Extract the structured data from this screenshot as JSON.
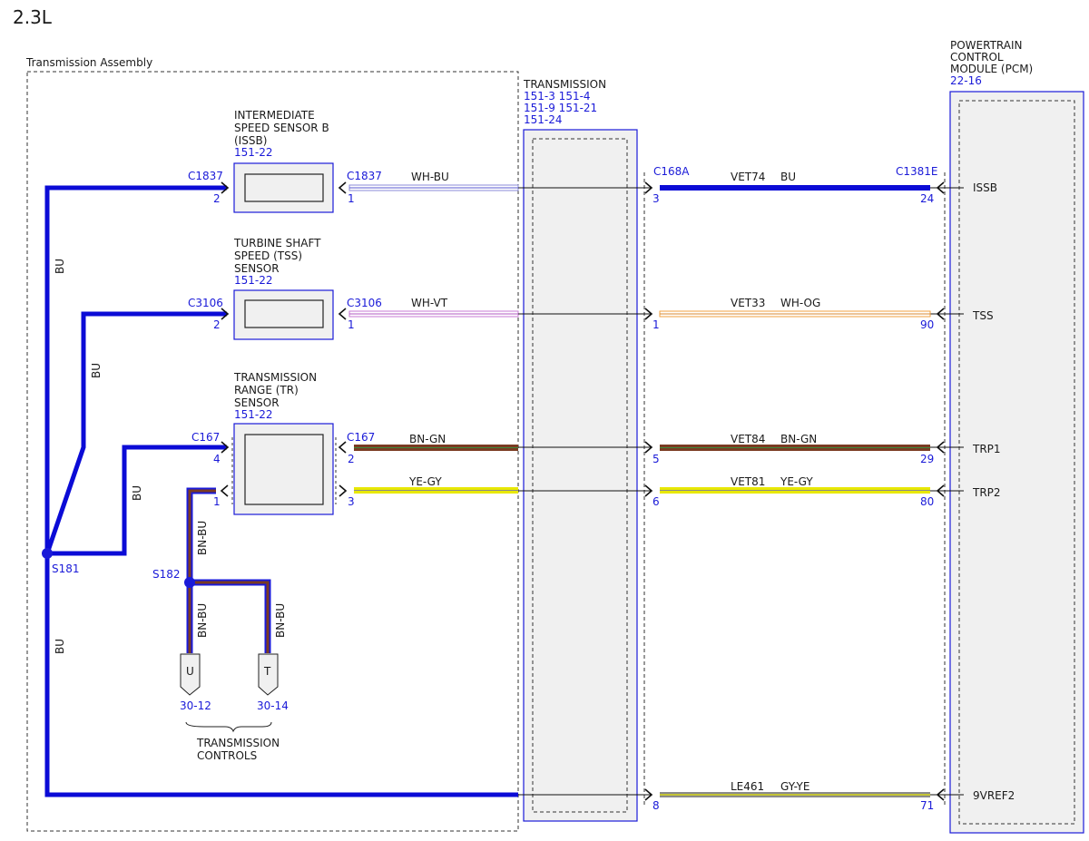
{
  "engine_label": "2.3L",
  "colors": {
    "connector_blue": "#1a1ad8",
    "wire_BU": "#0b0bd6",
    "wire_BN": "#7a3b22",
    "wire_GN": "#3c8a3c",
    "wire_YE": "#e8e800",
    "wire_GY": "#8a8a8a",
    "wire_WH": "#ffffff",
    "wire_VT": "#c77ad6",
    "wire_OG": "#f0a040",
    "module_fill": "#f0f0f0"
  },
  "transmission_assembly": {
    "label": "Transmission Assembly"
  },
  "issb": {
    "title": [
      "INTERMEDIATE",
      "SPEED SENSOR B",
      "(ISSB)"
    ],
    "ref": "151-22",
    "left_connector": "C1837",
    "left_pin": "2",
    "right_connector": "C1837",
    "right_pin": "1"
  },
  "tss": {
    "title": [
      "TURBINE SHAFT",
      "SPEED (TSS)",
      "SENSOR"
    ],
    "ref": "151-22",
    "left_connector": "C3106",
    "left_pin": "2",
    "right_connector": "C3106",
    "right_pin": "1"
  },
  "tr": {
    "title": [
      "TRANSMISSION",
      "RANGE (TR)",
      "SENSOR"
    ],
    "ref": "151-22",
    "left_connector": "C167",
    "left_pin_top": "4",
    "left_pin_bottom": "1",
    "right_connector": "C167",
    "right_pin_top": "2",
    "right_pin_bottom": "3"
  },
  "transmission_block": {
    "title": "TRANSMISSION",
    "refs": [
      "151-3 151-4",
      "151-9  151-21",
      "151-24"
    ]
  },
  "pcm": {
    "title": [
      "POWERTRAIN",
      "CONTROL",
      "MODULE (PCM)"
    ],
    "ref": "22-16",
    "c168a": "C168A",
    "c1381e": "C1381E"
  },
  "wires_left": {
    "issb_color": "WH-BU",
    "tss_color": "WH-VT",
    "trp1_color": "BN-GN",
    "trp2_color": "YE-GY"
  },
  "circuits": [
    {
      "name": "VET74",
      "color": "BU",
      "inline_pin": "3",
      "pcm_pin": "24",
      "signal": "ISSB"
    },
    {
      "name": "VET33",
      "color": "WH-OG",
      "inline_pin": "1",
      "pcm_pin": "90",
      "signal": "TSS"
    },
    {
      "name": "VET84",
      "color": "BN-GN",
      "inline_pin": "5",
      "pcm_pin": "29",
      "signal": "TRP1"
    },
    {
      "name": "VET81",
      "color": "YE-GY",
      "inline_pin": "6",
      "pcm_pin": "80",
      "signal": "TRP2"
    },
    {
      "name": "LE461",
      "color": "GY-YE",
      "inline_pin": "8",
      "pcm_pin": "71",
      "signal": "9VREF2"
    }
  ],
  "splices": {
    "s181": "S181",
    "s182": "S182"
  },
  "bus_labels": {
    "bu": "BU",
    "bn_bu": "BN-BU"
  },
  "transmission_controls": {
    "label": [
      "TRANSMISSION",
      "CONTROLS"
    ],
    "u_letter": "U",
    "u_ref": "30-12",
    "t_letter": "T",
    "t_ref": "30-14"
  }
}
